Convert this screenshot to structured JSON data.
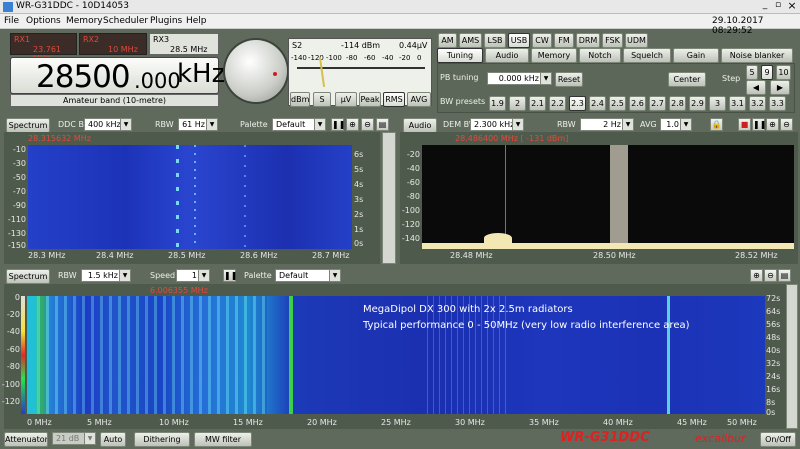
{
  "title_bar": {
    "title": "WR-G31DDC - 10D14053",
    "min": "_",
    "restore": "▫",
    "close": "×"
  },
  "menu": {
    "items": [
      "File",
      "Options",
      "Memory",
      "Scheduler",
      "Plugins",
      "Help"
    ],
    "datetime": "29.10.2017 08:29:52"
  },
  "receivers": {
    "rx1": {
      "label": "RX1",
      "freq": "23.761 MHz"
    },
    "rx2": {
      "label": "RX2",
      "freq": "10 MHz"
    },
    "rx3": {
      "label": "RX3",
      "freq": "28.5 MHz"
    }
  },
  "frequency": {
    "main": "28500",
    "fraction": ".000",
    "unit": "kHz",
    "band": "Amateur band (10-metre)"
  },
  "smeter": {
    "s_label": "S2",
    "dbm": "-114 dBm",
    "uv": "0.44μV",
    "scale": [
      "-140",
      "-120",
      "-100",
      "-80",
      "-60",
      "-40",
      "-20",
      "0"
    ],
    "buttons": [
      "dBm",
      "S",
      "μV",
      "Peak",
      "RMS",
      "AVG"
    ]
  },
  "modes": [
    "AM",
    "AMS",
    "LSB",
    "USB",
    "CW",
    "FM",
    "DRM",
    "FSK",
    "UDM"
  ],
  "active_mode": "USB",
  "tabs": [
    "Tuning",
    "Audio",
    "Memory",
    "Notch",
    "Squelch",
    "Gain",
    "Noise blanker"
  ],
  "active_tab": "Tuning",
  "tuning": {
    "pb_label": "PB tuning",
    "pb_value": "0.000 kHz",
    "reset": "Reset",
    "center": "Center",
    "step_label": "Step",
    "steps": [
      "5",
      "9",
      "10"
    ],
    "bw_label": "BW presets",
    "bw": [
      "1.9",
      "2",
      "2.1",
      "2.2",
      "2.3",
      "2.4",
      "2.5",
      "2.6",
      "2.7",
      "2.8",
      "2.9",
      "3",
      "3.1",
      "3.2",
      "3.3"
    ],
    "bw_active": "2.3"
  },
  "spectrum1": {
    "btn": "Spectrum",
    "ddc_label": "DDC BW",
    "ddc": "400 kHz",
    "rbw_label": "RBW",
    "rbw": "61 Hz",
    "palette_label": "Palette",
    "palette": "Default",
    "marker": "28.315632 MHz",
    "y": [
      "-10",
      "-30",
      "-50",
      "-70",
      "-90",
      "-110",
      "-130",
      "-150"
    ],
    "time": [
      "6s",
      "5s",
      "4s",
      "3s",
      "2s",
      "1s",
      "0s"
    ],
    "x": [
      "28.3 MHz",
      "28.4 MHz",
      "28.5 MHz",
      "28.6 MHz",
      "28.7 MHz"
    ]
  },
  "audio": {
    "btn": "Audio",
    "dem_label": "DEM BW",
    "dem": "2.300 kHz",
    "rbw_label": "RBW",
    "rbw": "2 Hz",
    "avg_label": "AVG",
    "avg": "1.0 s",
    "marker": "28.486400 MHz [ -131 dBm]",
    "y": [
      "-20",
      "-40",
      "-60",
      "-80",
      "-100",
      "-120",
      "-140"
    ],
    "x": [
      "28.48 MHz",
      "28.50 MHz",
      "28.52 MHz"
    ]
  },
  "spectrum2": {
    "btn": "Spectrum",
    "rbw_label": "RBW",
    "rbw": "1.5 kHz",
    "speed_label": "Speed",
    "speed": "1",
    "palette_label": "Palette",
    "palette": "Default",
    "marker": "6.006355 MHz",
    "y": [
      "0",
      "-20",
      "-40",
      "-60",
      "-80",
      "-100",
      "-120"
    ],
    "time": [
      "72s",
      "64s",
      "56s",
      "48s",
      "40s",
      "32s",
      "24s",
      "16s",
      "8s",
      "0s"
    ],
    "x": [
      "0 MHz",
      "5 MHz",
      "10 MHz",
      "15 MHz",
      "20 MHz",
      "25 MHz",
      "30 MHz",
      "35 MHz",
      "40 MHz",
      "45 MHz",
      "50 MHz"
    ],
    "annotation1": "MegaDipol DX 300 with 2x 2.5m radiators",
    "annotation2": "Typical performance 0 - 50MHz (very low radio interference area)"
  },
  "bottom": {
    "attenuator": "Attenuator",
    "att_value": "21 dB",
    "auto": "Auto",
    "dithering": "Dithering",
    "mw": "MW filter",
    "brand": "WR-G31DDC",
    "brand2": "excalibur",
    "onoff": "On/Off"
  },
  "colors": {
    "waterfall": "#1d34c0",
    "spectrum_bg": "#0a0a0a",
    "trace": "#f3e7b4",
    "marker": "#e24a3a"
  }
}
